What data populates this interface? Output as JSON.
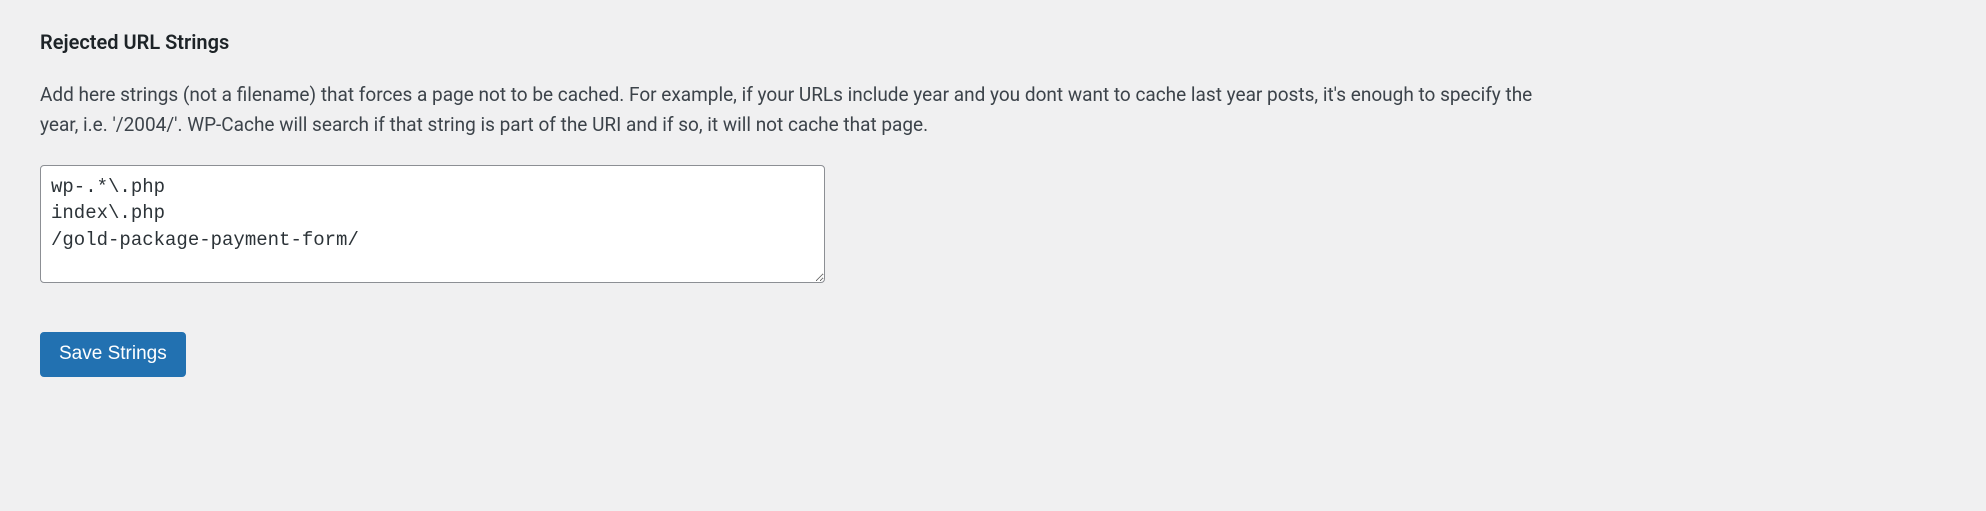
{
  "section": {
    "title": "Rejected URL Strings",
    "description": "Add here strings (not a filename) that forces a page not to be cached. For example, if your URLs include year and you dont want to cache last year posts, it's enough to specify the year, i.e. '/2004/'. WP-Cache will search if that string is part of the URI and if so, it will not cache that page."
  },
  "form": {
    "textarea_value": "wp-.*\\.php\nindex\\.php\n/gold-package-payment-form/",
    "submit_label": "Save Strings"
  }
}
